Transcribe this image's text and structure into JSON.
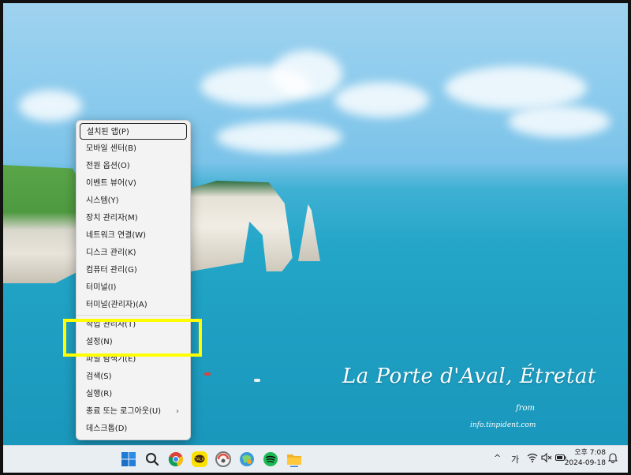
{
  "wallpaper": {
    "caption": "La Porte d'Aval, Étretat",
    "credit_from": "from",
    "credit_site": "info.tinpident.com"
  },
  "start_context_menu": {
    "items": [
      {
        "label": "설치된 앱(P)",
        "selected": true
      },
      {
        "label": "모바일 센터(B)"
      },
      {
        "label": "전원 옵션(O)"
      },
      {
        "label": "이벤트 뷰어(V)"
      },
      {
        "label": "시스템(Y)"
      },
      {
        "label": "장치 관리자(M)"
      },
      {
        "label": "네트워크 연결(W)"
      },
      {
        "label": "디스크 관리(K)"
      },
      {
        "label": "컴퓨터 관리(G)"
      },
      {
        "label": "터미널(I)"
      },
      {
        "label": "터미널(관리자)(A)"
      },
      {
        "label": "작업 관리자(T)"
      },
      {
        "label": "설정(N)"
      },
      {
        "label": "파일 탐색기(E)"
      },
      {
        "label": "검색(S)"
      },
      {
        "label": "실행(R)"
      },
      {
        "label": "종료 또는 로그아웃(U)",
        "submenu_icon": "chevron-right-icon"
      },
      {
        "label": "데스크톱(D)"
      }
    ],
    "highlight_color": "#ffff00"
  },
  "taskbar": {
    "apps": [
      "windows-start-icon",
      "search-icon",
      "chrome-icon",
      "kakaotalk-icon",
      "edge-icon",
      "photos-icon",
      "spotify-icon",
      "file-explorer-icon"
    ],
    "tray": {
      "chevron": "^",
      "ime": "가",
      "time": "오후 7:08",
      "date": "2024-09-18"
    }
  }
}
